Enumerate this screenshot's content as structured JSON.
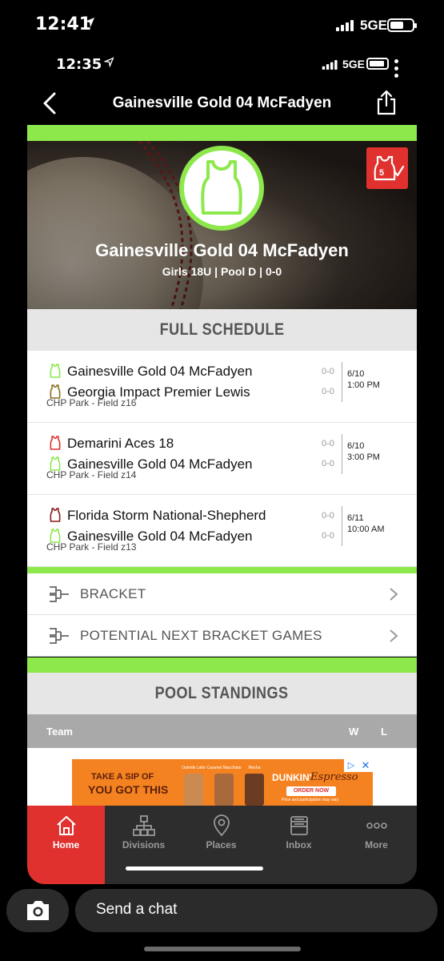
{
  "outer_status": {
    "time": "12:41",
    "network": "5GE"
  },
  "inner_status": {
    "time": "12:35",
    "network": "5GE"
  },
  "nav": {
    "title": "Gainesville Gold 04 McFadyen"
  },
  "team": {
    "name": "Gainesville Gold 04 McFadyen",
    "subtitle": "Girls 18U | Pool D | 0-0",
    "badge_number": "5"
  },
  "schedule": {
    "header": "FULL SCHEDULE",
    "games": [
      {
        "team1": "Gainesville Gold 04 McFadyen",
        "team1_color": "#8ce84b",
        "team2": "Georgia Impact Premier Lewis",
        "team2_color": "#8a6d1e",
        "score1": "0-0",
        "score2": "0-0",
        "date": "6/10",
        "time": "1:00 PM",
        "location": "CHP Park - Field z16"
      },
      {
        "team1": "Demarini Aces 18",
        "team1_color": "#e0312e",
        "team2": "Gainesville Gold 04 McFadyen",
        "team2_color": "#8ce84b",
        "score1": "0-0",
        "score2": "0-0",
        "date": "6/10",
        "time": "3:00 PM",
        "location": "CHP Park - Field z14"
      },
      {
        "team1": "Florida Storm National-Shepherd",
        "team1_color": "#8b1a1a",
        "team2": "Gainesville Gold 04 McFadyen",
        "team2_color": "#8ce84b",
        "score1": "0-0",
        "score2": "0-0",
        "date": "6/11",
        "time": "10:00 AM",
        "location": "CHP Park - Field z13"
      }
    ]
  },
  "menu": {
    "bracket": "BRACKET",
    "potential": "POTENTIAL NEXT BRACKET GAMES"
  },
  "standings": {
    "header": "POOL STANDINGS",
    "col_team": "Team",
    "col_w": "W",
    "col_l": "L"
  },
  "ad": {
    "line1": "TAKE A SIP OF",
    "line2": "YOU GOT THIS",
    "brand": "DUNKIN'",
    "brand2": "Espresso",
    "cta": "ORDER NOW",
    "fine": "Price and participation may vary.",
    "cup_labels": [
      "Oatmilk Latte",
      "Caramel Macchiato",
      "Mocha"
    ]
  },
  "tabs": [
    {
      "label": "Home",
      "icon": "home-icon"
    },
    {
      "label": "Divisions",
      "icon": "divisions-icon"
    },
    {
      "label": "Places",
      "icon": "places-icon"
    },
    {
      "label": "Inbox",
      "icon": "inbox-icon"
    },
    {
      "label": "More",
      "icon": "more-icon"
    }
  ],
  "chat": {
    "placeholder": "Send a chat"
  }
}
